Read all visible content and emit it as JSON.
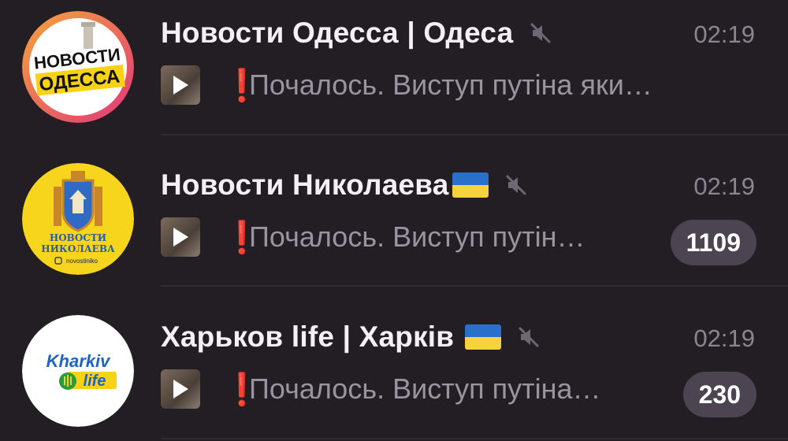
{
  "chats": [
    {
      "title": "Новости Одесса | Одеса",
      "time": "02:19",
      "preview": "Почалось. Виступ путіна  яки…",
      "exclaim": "❗",
      "unread": "",
      "muted": true,
      "flag": false,
      "avatar_text": [
        "НОВОСТИ",
        "ОДЕССА"
      ]
    },
    {
      "title": "Новости Николаева",
      "time": "02:19",
      "preview": "Почалось. Виступ путін…",
      "exclaim": "❗",
      "unread": "1109",
      "muted": true,
      "flag": true,
      "avatar_text": [
        "НОВОСТИ",
        "НИКОЛАЕВА",
        "novostiniko"
      ]
    },
    {
      "title": "Харьков life | Харків",
      "time": "02:19",
      "preview": "Почалось. Виступ путіна…",
      "exclaim": "❗",
      "unread": "230",
      "muted": true,
      "flag": true,
      "avatar_text": [
        "Kharkiv",
        "life"
      ]
    }
  ],
  "colors": {
    "background": "#221e24",
    "title": "#f2f0f4",
    "secondary": "#9a93a0",
    "badge": "#4c4551",
    "alert": "#e0222e",
    "flag_blue": "#2a6fc9",
    "flag_yellow": "#f6d23c"
  },
  "icons": {
    "mute": "speaker-muted-icon",
    "media": "video-play-icon",
    "alert": "exclamation-icon"
  }
}
